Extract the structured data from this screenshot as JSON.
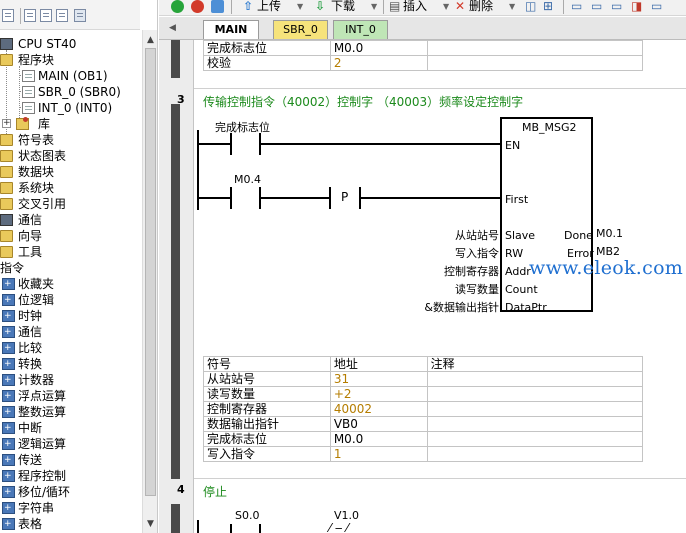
{
  "toolbar": {
    "upload_label": "上传",
    "download_label": "下载",
    "insert_label": "插入",
    "delete_label": "删除"
  },
  "tabs": [
    {
      "label": "MAIN"
    },
    {
      "label": "SBR_0"
    },
    {
      "label": "INT_0"
    }
  ],
  "tree": {
    "cpu": "CPU ST40",
    "program_block": "程序块",
    "pou_main": "MAIN (OB1)",
    "pou_sbr": "SBR_0 (SBR0)",
    "pou_int": "INT_0 (INT0)",
    "library": "库",
    "symbol_table": "符号表",
    "status_chart": "状态图表",
    "data_block": "数据块",
    "system_block": "系统块",
    "cross_ref": "交叉引用",
    "comms": "通信",
    "wizard": "向导",
    "tools": "工具",
    "instructions": "指令",
    "instr_items": [
      "收藏夹",
      "位逻辑",
      "时钟",
      "通信",
      "比较",
      "转换",
      "计数器",
      "浮点运算",
      "整数运算",
      "中断",
      "逻辑运算",
      "传送",
      "程序控制",
      "移位/循环",
      "字符串",
      "表格"
    ]
  },
  "network2_tail": {
    "rows": [
      {
        "symbol": "完成标志位",
        "address": "M0.0",
        "comment": ""
      },
      {
        "symbol": "校验",
        "address": "2",
        "comment": ""
      }
    ]
  },
  "network3": {
    "number": "3",
    "title": "传输控制指令（40002）控制字  （40003）频率设定控制字",
    "contact1_label": "完成标志位",
    "contact2_label": "M0.4",
    "p_label": "P",
    "block_name": "MB_MSG2",
    "pins_left": [
      "EN",
      "First",
      "Slave",
      "RW",
      "Addr",
      "Count",
      "DataPtr"
    ],
    "pins_right": [
      "Done",
      "Error"
    ],
    "params": [
      "从站站号",
      "写入指令",
      "控制寄存器",
      "读写数量",
      "&数据输出指针"
    ],
    "outputs": [
      "M0.1",
      "MB2"
    ],
    "table_head": {
      "symbol": "符号",
      "address": "地址",
      "comment": "注释"
    },
    "rows": [
      {
        "symbol": "从站站号",
        "address": "31",
        "comment": ""
      },
      {
        "symbol": "读写数量",
        "address": "+2",
        "comment": ""
      },
      {
        "symbol": "控制寄存器",
        "address": "40002",
        "comment": ""
      },
      {
        "symbol": "数据输出指针",
        "address": "VB0",
        "comment": ""
      },
      {
        "symbol": "完成标志位",
        "address": "M0.0",
        "comment": ""
      },
      {
        "symbol": "写入指令",
        "address": "1",
        "comment": ""
      }
    ]
  },
  "network4": {
    "number": "4",
    "title": "停止",
    "contact1_label": "S0.0",
    "contact2_label": "V1.0"
  },
  "watermark": "www.eleok.com",
  "colors": {
    "network_title": "#1c8a1c",
    "value_text": "#b57d00",
    "watermark": "#1f6fd0"
  }
}
